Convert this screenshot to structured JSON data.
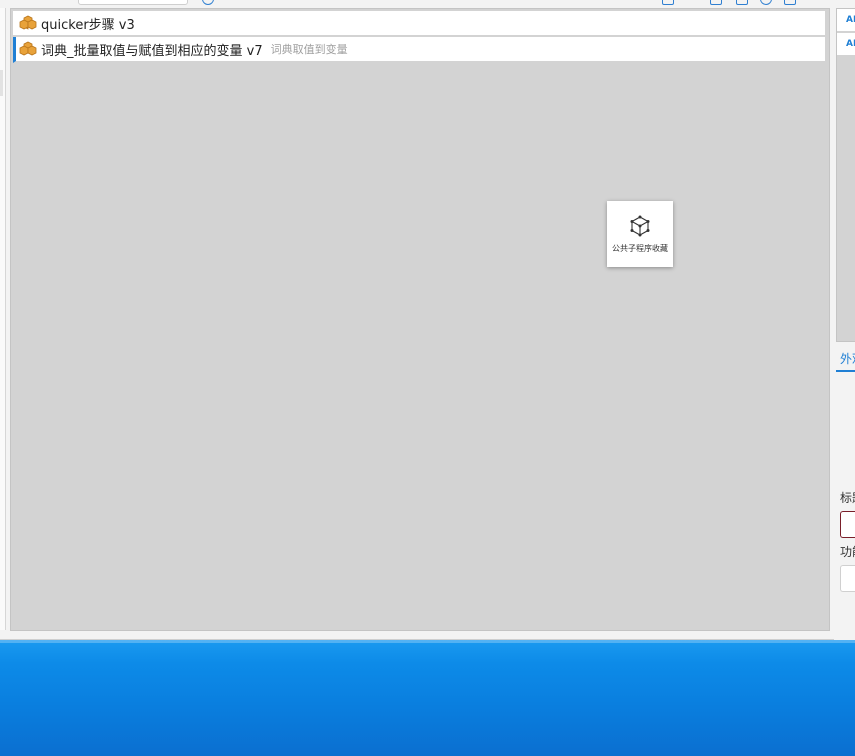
{
  "canvas": {
    "steps": [
      {
        "name": "quicker步骤 v3",
        "note": "",
        "icon": "boxes-icon",
        "selected": false
      },
      {
        "name": "词典_批量取值与赋值到相应的变量 v7",
        "note": "词典取值到变量",
        "icon": "boxes-icon",
        "selected": true
      }
    ],
    "subroutine_card": {
      "label": "公共子程序收藏",
      "icon": "cube-network-icon"
    }
  },
  "right_panel": {
    "list_items": [
      "AB",
      "AB"
    ],
    "tab_label": "外观",
    "title_label": "标题",
    "function_label": "功能"
  },
  "colors": {
    "accent": "#1f7fd4",
    "canvas_bg": "#d3d3d3",
    "step_icon": "#e8a23a",
    "focus_border": "#7a1f2a",
    "desktop": "#0a7fdf"
  }
}
